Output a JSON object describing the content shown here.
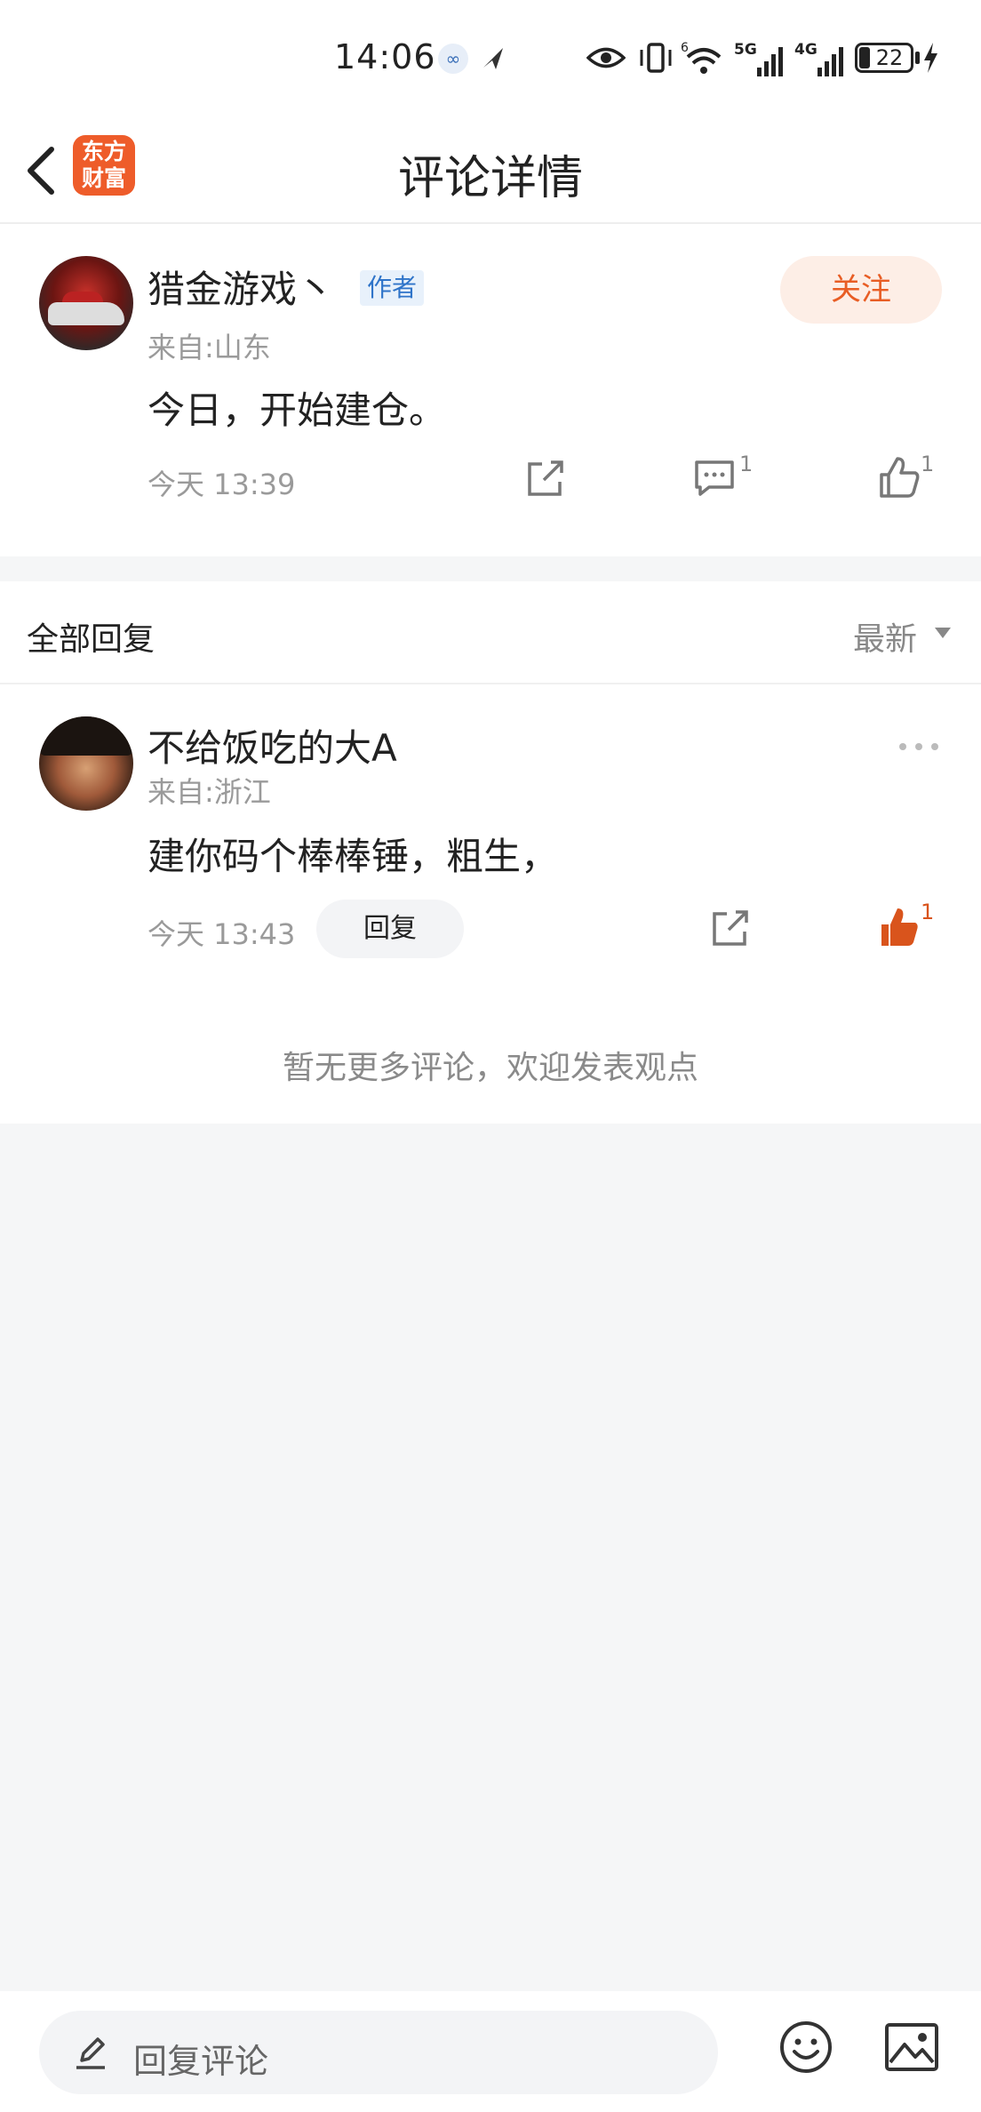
{
  "status_bar": {
    "time": "14:06",
    "network_1": "5G",
    "network_2": "4G",
    "wifi_badge": "6",
    "battery": "22"
  },
  "header": {
    "logo_line1": "东方",
    "logo_line2": "财富",
    "title": "评论详情"
  },
  "main_comment": {
    "username": "猎金游戏丶",
    "badge": "作者",
    "location": "来自:山东",
    "follow_label": "关注",
    "text": "今日，开始建仓。",
    "time": "今天 13:39",
    "comment_count": "1",
    "like_count": "1"
  },
  "replies_section": {
    "title": "全部回复",
    "sort_label": "最新"
  },
  "reply": {
    "username": "不给饭吃的大A",
    "location": "来自:浙江",
    "text": "建你码个棒棒锤，粗生，",
    "time": "今天 13:43",
    "reply_label": "回复",
    "like_count": "1"
  },
  "footer_note": "暂无更多评论，欢迎发表观点",
  "bottom_bar": {
    "placeholder": "回复评论"
  },
  "colors": {
    "accent": "#e85d24",
    "badge_blue": "#2f74c9",
    "liked": "#d9541c"
  }
}
